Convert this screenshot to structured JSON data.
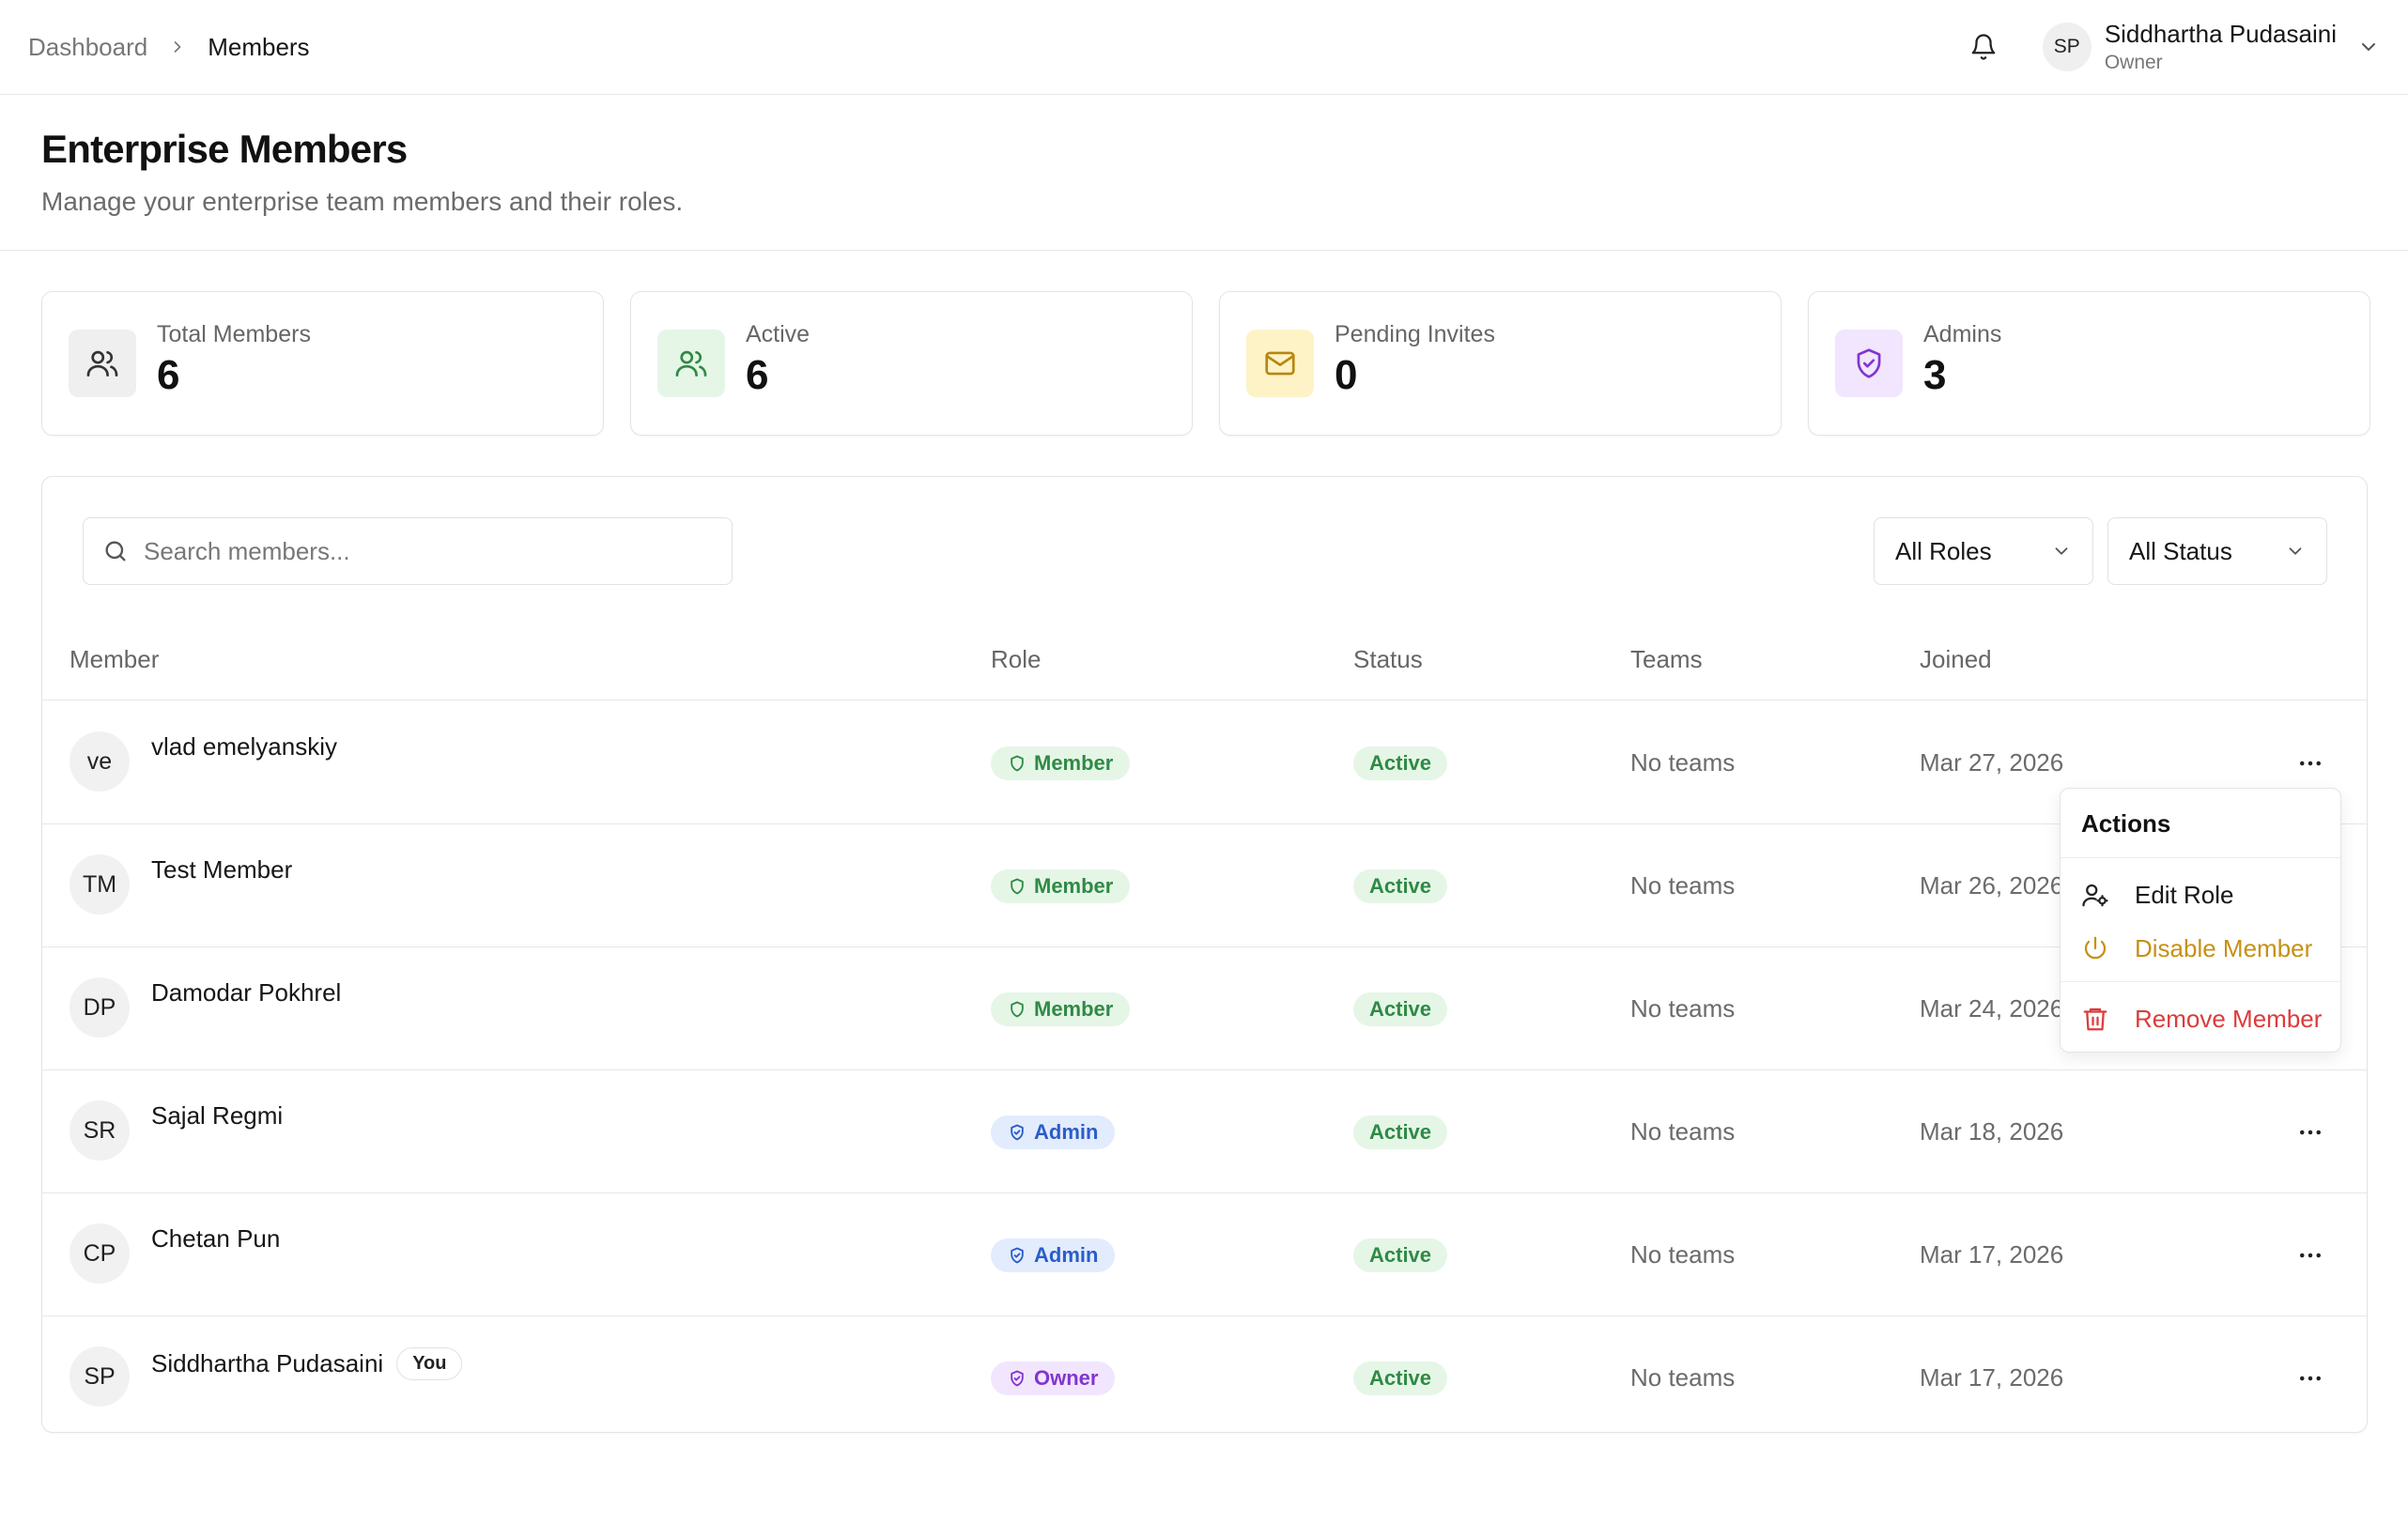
{
  "breadcrumb": {
    "root": "Dashboard",
    "current": "Members"
  },
  "user": {
    "initials": "SP",
    "name": "Siddhartha Pudasaini",
    "role": "Owner"
  },
  "header": {
    "title": "Enterprise Members",
    "subtitle": "Manage your enterprise team members and their roles."
  },
  "stats": [
    {
      "label": "Total Members",
      "value": "6",
      "icon": "users-icon",
      "bg": "#efefef",
      "fg": "#333333"
    },
    {
      "label": "Active",
      "value": "6",
      "icon": "users-icon",
      "bg": "#e5f6e7",
      "fg": "#2f8a45"
    },
    {
      "label": "Pending Invites",
      "value": "0",
      "icon": "mail-icon",
      "bg": "#fdf3c7",
      "fg": "#b7860f"
    },
    {
      "label": "Admins",
      "value": "3",
      "icon": "shield-check-icon",
      "bg": "#f1e6fd",
      "fg": "#8235d0"
    }
  ],
  "search": {
    "placeholder": "Search members..."
  },
  "filters": {
    "roles": "All Roles",
    "status": "All Status"
  },
  "table": {
    "columns": [
      "Member",
      "Role",
      "Status",
      "Teams",
      "Joined"
    ],
    "rows": [
      {
        "initials": "ve",
        "name": "vlad emelyanskiy",
        "role": "Member",
        "status": "Active",
        "teams": "No teams",
        "joined": "Mar 27, 2026"
      },
      {
        "initials": "TM",
        "name": "Test Member",
        "role": "Member",
        "status": "Active",
        "teams": "No teams",
        "joined": "Mar 26, 2026"
      },
      {
        "initials": "DP",
        "name": "Damodar Pokhrel",
        "role": "Member",
        "status": "Active",
        "teams": "No teams",
        "joined": "Mar 24, 2026"
      },
      {
        "initials": "SR",
        "name": "Sajal Regmi",
        "role": "Admin",
        "status": "Active",
        "teams": "No teams",
        "joined": "Mar 18, 2026"
      },
      {
        "initials": "CP",
        "name": "Chetan Pun",
        "role": "Admin",
        "status": "Active",
        "teams": "No teams",
        "joined": "Mar 17, 2026"
      },
      {
        "initials": "SP",
        "name": "Siddhartha Pudasaini",
        "you": "You",
        "role": "Owner",
        "status": "Active",
        "teams": "No teams",
        "joined": "Mar 17, 2026"
      }
    ]
  },
  "menu": {
    "title": "Actions",
    "edit": "Edit Role",
    "disable": "Disable Member",
    "remove": "Remove Member"
  }
}
